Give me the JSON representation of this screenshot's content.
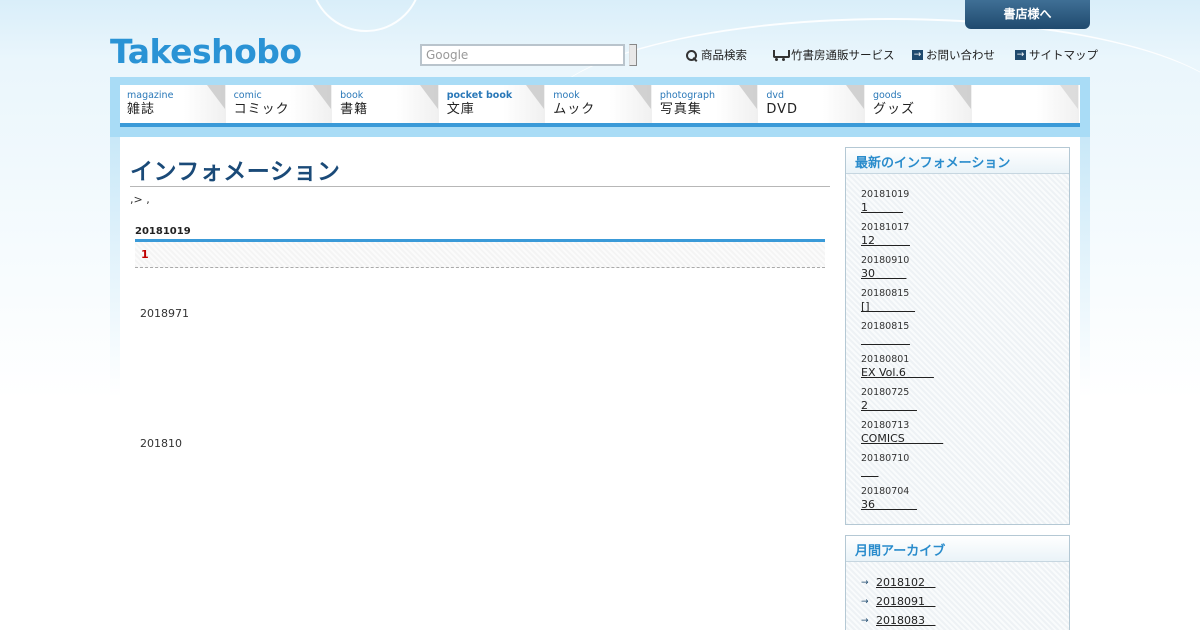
{
  "header": {
    "logo": "Takeshobo",
    "store_button": "書店様へ",
    "search_placeholder": "Google",
    "links": [
      {
        "label": "商品検索",
        "icon": "magnifier-icon"
      },
      {
        "label": "竹書房通販サービス",
        "icon": "cart-icon"
      },
      {
        "label": "お問い合わせ",
        "icon": "arrow-right-icon"
      },
      {
        "label": "サイトマップ",
        "icon": "arrow-right-icon"
      }
    ]
  },
  "nav": [
    {
      "en": "magazine",
      "jp": "雑誌"
    },
    {
      "en": "comic",
      "jp": "コミック"
    },
    {
      "en": "book",
      "jp": "書籍"
    },
    {
      "en": "pocket book",
      "jp": "文庫"
    },
    {
      "en": "mook",
      "jp": "ムック"
    },
    {
      "en": "photograph",
      "jp": "写真集"
    },
    {
      "en": "dvd",
      "jp": "DVD"
    },
    {
      "en": "goods",
      "jp": "グッズ"
    }
  ],
  "main": {
    "title": "インフォメーション",
    "breadcrumb": ",> ,",
    "entry": {
      "date": "20181019",
      "title": "1",
      "paragraphs": [
        "2018971",
        "201810"
      ]
    }
  },
  "sidebar": {
    "latest_title": "最新のインフォメーション",
    "latest": [
      {
        "date": "20181019",
        "link": "1          "
      },
      {
        "date": "20181017",
        "link": "12          "
      },
      {
        "date": "20180910",
        "link": "30         "
      },
      {
        "date": "20180815",
        "link": "[]             "
      },
      {
        "date": "20180815",
        "link": "              "
      },
      {
        "date": "20180801",
        "link": "EX Vol.6        "
      },
      {
        "date": "20180725",
        "link": "2              "
      },
      {
        "date": "20180713",
        "link": "COMICS           "
      },
      {
        "date": "20180710",
        "link": "     "
      },
      {
        "date": "20180704",
        "link": "36            "
      }
    ],
    "archive_title": "月間アーカイブ",
    "archive": [
      "2018102   ",
      "2018091   ",
      "2018083   "
    ]
  }
}
